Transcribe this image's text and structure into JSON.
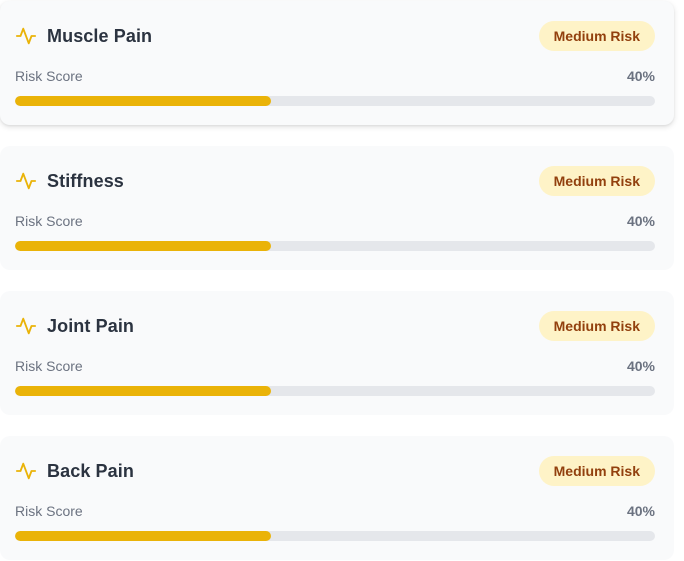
{
  "accent_color": "#eab308",
  "badge_bg": "#fef3c7",
  "badge_text": "#92400e",
  "cards": [
    {
      "icon": "activity-pulse-icon",
      "title": "Muscle Pain",
      "badge": "Medium Risk",
      "score_label": "Risk Score",
      "score_text": "40%",
      "score_percent": 40
    },
    {
      "icon": "activity-pulse-icon",
      "title": "Stiffness",
      "badge": "Medium Risk",
      "score_label": "Risk Score",
      "score_text": "40%",
      "score_percent": 40
    },
    {
      "icon": "activity-pulse-icon",
      "title": "Joint Pain",
      "badge": "Medium Risk",
      "score_label": "Risk Score",
      "score_text": "40%",
      "score_percent": 40
    },
    {
      "icon": "activity-pulse-icon",
      "title": "Back Pain",
      "badge": "Medium Risk",
      "score_label": "Risk Score",
      "score_text": "40%",
      "score_percent": 40
    }
  ]
}
